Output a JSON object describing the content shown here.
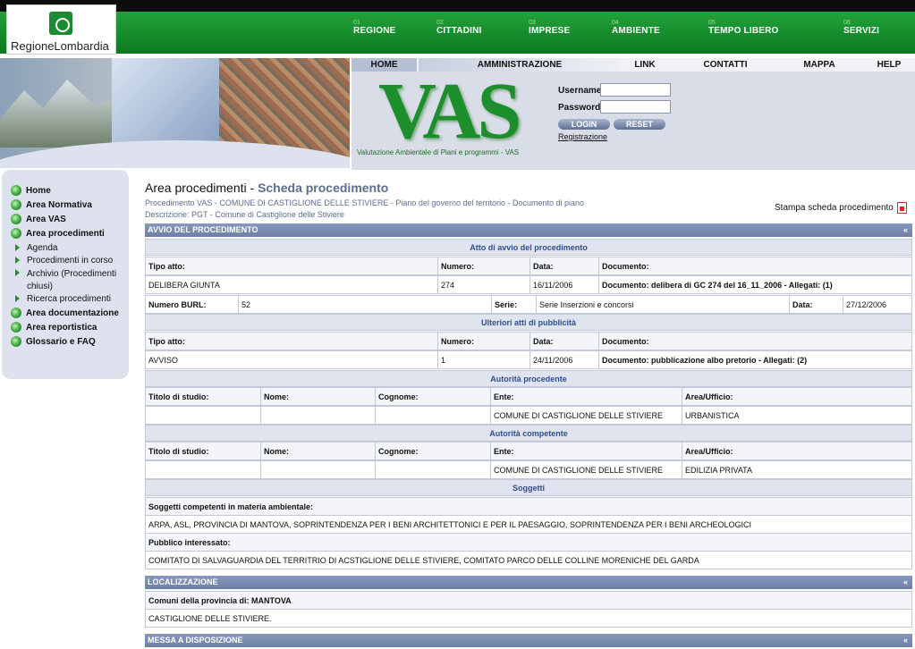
{
  "logo": {
    "text": "RegioneLombardia"
  },
  "top_nav": [
    {
      "num": "01",
      "label": "REGIONE"
    },
    {
      "num": "02",
      "label": "CITTADINI"
    },
    {
      "num": "03",
      "label": "IMPRESE"
    },
    {
      "num": "04",
      "label": "AMBIENTE"
    },
    {
      "num": "05",
      "label": "TEMPO LIBERO"
    },
    {
      "num": "06",
      "label": "SERVIZI"
    }
  ],
  "sub_nav": [
    "HOME",
    "AMMINISTRAZIONE",
    "LINK",
    "CONTATTI",
    "MAPPA",
    "HELP"
  ],
  "vas": {
    "logo": "VAS",
    "subtitle": "Valutazione Ambientale di Piani e programmi - VAS"
  },
  "login": {
    "username_label": "Username",
    "password_label": "Password",
    "login_btn": "LOGIN",
    "reset_btn": "RESET",
    "register": "Registrazione"
  },
  "sidebar": {
    "items": [
      {
        "label": "Home",
        "kind": "main"
      },
      {
        "label": "Area Normativa",
        "kind": "main"
      },
      {
        "label": "Area VAS",
        "kind": "main"
      },
      {
        "label": "Area procedimenti",
        "kind": "main"
      },
      {
        "label": "Agenda",
        "kind": "sub"
      },
      {
        "label": "Procedimenti in corso",
        "kind": "sub"
      },
      {
        "label": "Archivio (Procedimenti chiusi)",
        "kind": "sub"
      },
      {
        "label": "Ricerca procedimenti",
        "kind": "sub"
      },
      {
        "label": "Area documentazione",
        "kind": "main"
      },
      {
        "label": "Area reportistica",
        "kind": "main"
      },
      {
        "label": "Glossario e FAQ",
        "kind": "main"
      }
    ]
  },
  "page": {
    "title": "Area procedimenti - ",
    "subtitle": "Scheda procedimento",
    "crumb1": "Procedimento VAS - COMUNE DI CASTIGLIONE DELLE STIVIERE - Piano del governo del territorio - Documento di piano",
    "crumb2": "Descrizione: PGT - Comune di Castiglione delle Stiviere",
    "print": "Stampa scheda procedimento"
  },
  "avvio": {
    "bar": "AVVIO DEL PROCEDIMENTO",
    "chev": "«",
    "atto_title": "Atto di avvio del procedimento",
    "headers": [
      "Tipo atto:",
      "Numero:",
      "Data:",
      "Documento:"
    ],
    "row": [
      "DELIBERA GIUNTA",
      "274",
      "16/11/2006",
      "Documento: delibera di GC 274 del 16_11_2006 - Allegati: (1)"
    ],
    "burl_label": "Numero BURL:",
    "burl_value": "52",
    "serie_label": "Serie:",
    "serie_value": "Serie Inserzioni e concorsi",
    "data_label": "Data:",
    "data_value": "27/12/2006",
    "ulteriori_title": "Ulteriori atti di pubblicità",
    "row2": [
      "AVVISO",
      "1",
      "24/11/2006",
      "Documento: pubblicazione albo pretorio - Allegati: (2)"
    ],
    "procedente_title": "Autorità procedente",
    "auth_headers": [
      "Titolo di studio:",
      "Nome:",
      "Cognome:",
      "Ente:",
      "Area/Ufficio:"
    ],
    "procedente_row": [
      "",
      "",
      "",
      "COMUNE DI CASTIGLIONE DELLE STIVIERE",
      "URBANISTICA"
    ],
    "competente_title": "Autorità competente",
    "competente_row": [
      "",
      "",
      "",
      "COMUNE DI CASTIGLIONE DELLE STIVIERE",
      "EDILIZIA PRIVATA"
    ],
    "soggetti_title": "Soggetti",
    "sogg_amb_label": "Soggetti competenti in materia ambientale:",
    "sogg_amb_value": "ARPA, ASL, PROVINCIA DI MANTOVA, SOPRINTENDENZA PER I BENI ARCHITETTONICI E PER IL PAESAGGIO, SOPRINTENDENZA PER I BENI ARCHEOLOGICI",
    "pubblico_label": "Pubblico interessato:",
    "pubblico_value": "COMITATO DI SALVAGUARDIA DEL TERRITRIO DI ACSTIGLIONE DELLE STIVIERE, COMITATO PARCO DELLE COLLINE MORENICHE DEL GARDA"
  },
  "localizzazione": {
    "bar": "LOCALIZZAZIONE",
    "chev": "«",
    "label": "Comuni della provincia di: MANTOVA",
    "value": "CASTIGLIONE DELLE STIVIERE."
  },
  "messa": {
    "bar": "MESSA A DISPOSIZIONE",
    "chev": "«"
  }
}
